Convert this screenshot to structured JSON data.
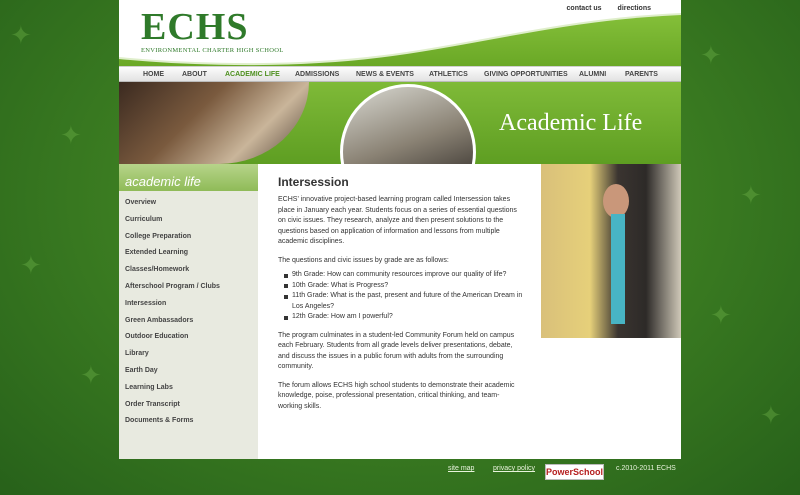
{
  "header": {
    "logo_title": "ECHS",
    "logo_subtitle": "ENVIRONMENTAL CHARTER HIGH SCHOOL",
    "top_links": [
      "contact us",
      "directions"
    ]
  },
  "nav": {
    "items": [
      "HOME",
      "ABOUT",
      "ACADEMIC LIFE",
      "ADMISSIONS",
      "NEWS & EVENTS",
      "ATHLETICS",
      "GIVING OPPORTUNITIES",
      "ALUMNI",
      "PARENTS"
    ],
    "active": "ACADEMIC LIFE"
  },
  "banner": {
    "title": "Academic Life"
  },
  "sidebar": {
    "heading": "academic life",
    "items": [
      "Overview",
      "Curriculum",
      "College Preparation",
      "Extended Learning",
      "Classes/Homework",
      "Afterschool Program / Clubs",
      "Intersession",
      "Green Ambassadors",
      "Outdoor Education",
      "Library",
      "Earth Day",
      "Learning Labs",
      "Order Transcript",
      "Documents & Forms"
    ]
  },
  "content": {
    "title": "Intersession",
    "para1": "ECHS' innovative project-based learning program called Intersession takes place in January each year. Students focus on a series of essential questions on civic issues. They research, analyze and then present solutions to the questions based on application of information and lessons from multiple academic disciplines.",
    "para2": "The questions and civic issues by grade are as follows:",
    "bullets": [
      "9th Grade: How can community resources improve our quality of life?",
      "10th Grade: What is Progress?",
      "11th Grade: What is the past, present and future of the American Dream in Los Angeles?",
      "12th Grade: How am I powerful?"
    ],
    "para3": "The program culminates in a student-led Community Forum held on campus each February.  Students from all grade levels deliver presentations, debate, and discuss the issues in a public forum with adults from the surrounding community.",
    "para4": "The forum allows ECHS high school students to demonstrate their academic knowledge, poise, professional presentation, critical thinking, and team-working skills."
  },
  "footer": {
    "site_map": "site map",
    "privacy_policy": "privacy policy",
    "powerschool": "PowerSchool",
    "copyright": "c.2010-2011 ECHS"
  },
  "colors": {
    "brand_green": "#6aa826",
    "logo_green": "#2f7a2a",
    "sidebar_bg": "#e8eae0"
  }
}
